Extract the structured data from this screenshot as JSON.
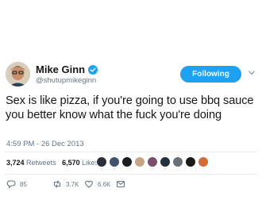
{
  "user": {
    "display_name": "Mike Ginn",
    "handle": "@shutupmikeginn",
    "verified": true
  },
  "follow_button": {
    "label": "Following",
    "color": "#1da1f2"
  },
  "tweet": {
    "text": "Sex is like pizza, if you're going to use bbq sauce you better know what the fuck you're doing",
    "timestamp": "4:59 PM - 26 Dec 2013"
  },
  "stats": {
    "retweets_count": "3,724",
    "retweets_label": "Retweets",
    "likes_count": "6,570",
    "likes_label": "Likes"
  },
  "liker_avatar_colors": [
    "#2b2f3a",
    "#41536b",
    "#1c1e22",
    "#c7a488",
    "#7a4e6f",
    "#23303d",
    "#6b6f78",
    "#1a1a1a",
    "#d36b3b"
  ],
  "actions": {
    "reply_count": "85",
    "retweet_count": "3.7K",
    "like_count": "6.6K"
  },
  "icons": [
    "verified-badge-icon",
    "chevron-down-icon",
    "reply-icon",
    "retweet-icon",
    "heart-icon",
    "direct-message-icon"
  ]
}
